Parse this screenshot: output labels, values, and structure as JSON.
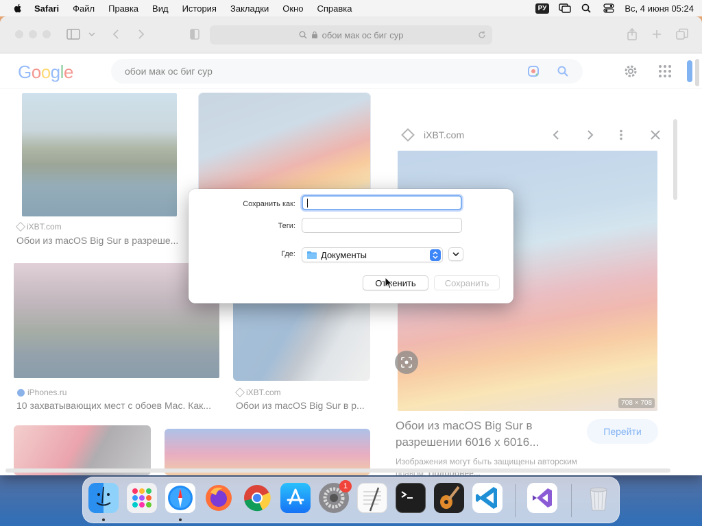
{
  "menubar": {
    "app_name": "Safari",
    "items": [
      "Файл",
      "Правка",
      "Вид",
      "История",
      "Закладки",
      "Окно",
      "Справка"
    ],
    "input_source": "РУ",
    "datetime": "Вс, 4 июня  05:24"
  },
  "browser": {
    "address": "обои мак ос биг сур"
  },
  "google": {
    "logo": "Google",
    "query": "обои мак ос биг сур"
  },
  "results": [
    {
      "source": "iXBT.com",
      "title": "Обои из macOS Big Sur в разреше..."
    },
    {
      "source": "iPhones.ru",
      "title": "10 захватывающих мест с обоев Mac. Как..."
    },
    {
      "source": "iXBT.com",
      "title": "Обои из macOS Big Sur в р..."
    }
  ],
  "panel": {
    "source": "iXBT.com",
    "image_size": "708 × 708",
    "title": "Обои из macOS Big Sur в разрешении 6016 x 6016...",
    "visit_label": "Перейти",
    "copyright": "Изображения могут быть защищены авторским правом.",
    "more": "Подробнее..."
  },
  "dialog": {
    "save_as_label": "Сохранить как:",
    "save_as_value": "",
    "tags_label": "Теги:",
    "tags_value": "",
    "where_label": "Где:",
    "where_value": "Документы",
    "cancel_label": "Отменить",
    "save_label": "Сохранить"
  },
  "dock": {
    "system_settings_badge": "1"
  }
}
